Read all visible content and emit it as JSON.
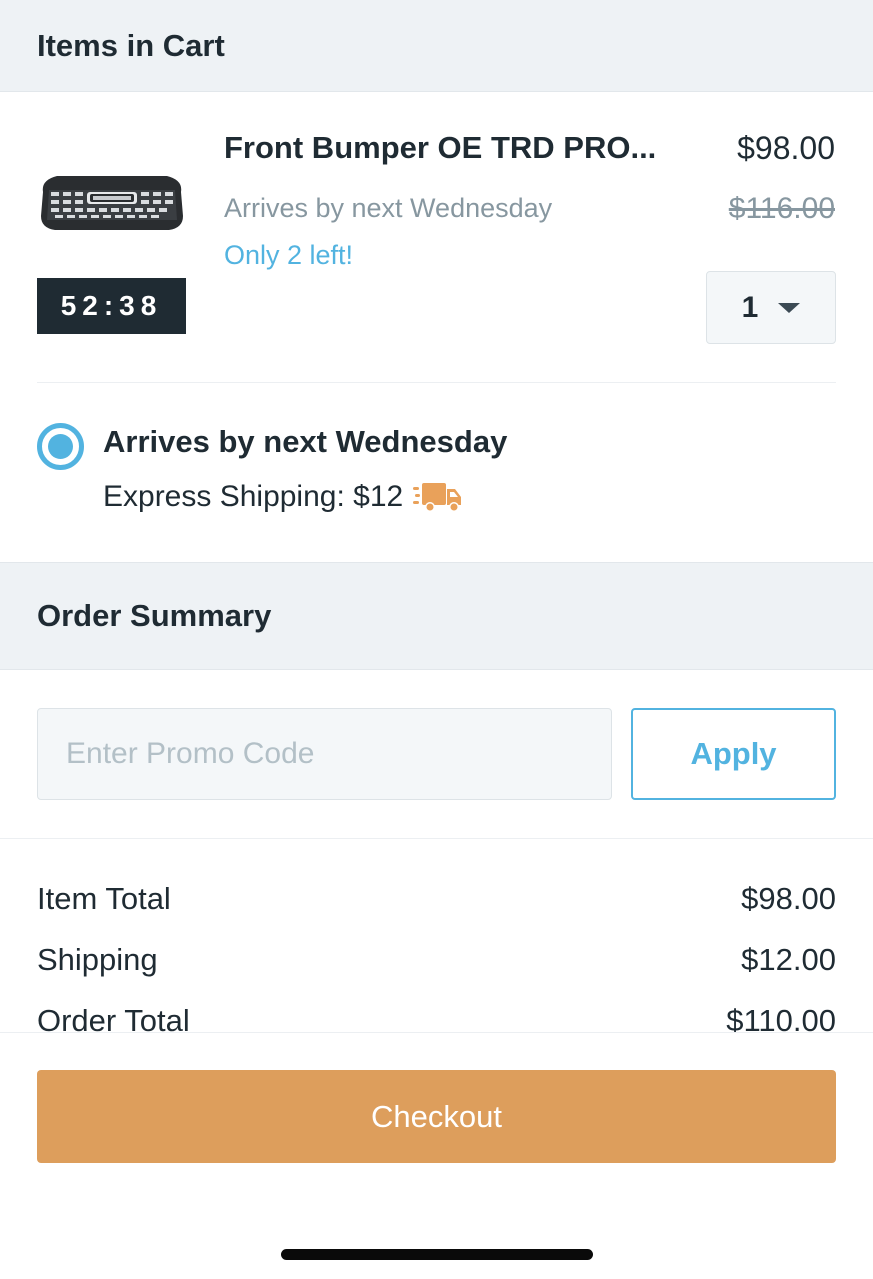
{
  "cart_header": {
    "title": "Items in Cart"
  },
  "item": {
    "name": "Front Bumper OE TRD PRO...",
    "arrival": "Arrives by next Wednesday",
    "stock": "Only 2 left!",
    "price": "$98.00",
    "original_price": "$116.00",
    "timer": "52:38",
    "quantity": "1",
    "image_icon": "toyota-grille-image"
  },
  "shipping": {
    "title": "Arrives by next Wednesday",
    "detail": "Express Shipping: $12",
    "icon": "truck-icon",
    "selected": true
  },
  "summary_header": {
    "title": "Order Summary"
  },
  "promo": {
    "placeholder": "Enter Promo Code",
    "value": "",
    "apply_label": "Apply"
  },
  "totals": {
    "item_total_label": "Item Total",
    "item_total_value": "$98.00",
    "shipping_label": "Shipping",
    "shipping_value": "$12.00",
    "order_total_label": "Order Total",
    "order_total_value": "$110.00"
  },
  "checkout": {
    "label": "Checkout"
  },
  "colors": {
    "accent": "#52b3e0",
    "checkout": "#dd9e5c",
    "dark": "#1f2b33",
    "muted": "#8797a0",
    "truck": "#e9a15a"
  }
}
